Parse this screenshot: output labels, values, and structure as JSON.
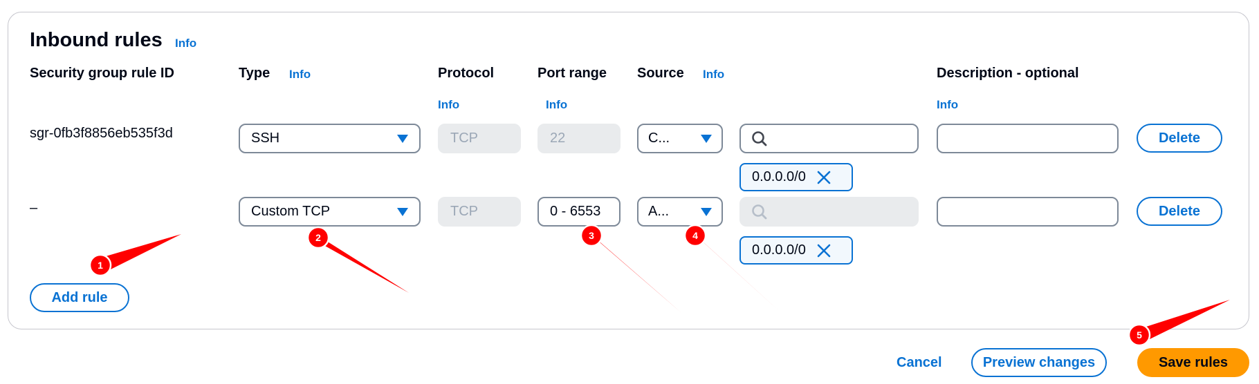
{
  "panel": {
    "title": "Inbound rules",
    "title_info": "Info"
  },
  "columns": {
    "rule_id": "Security group rule ID",
    "type": "Type",
    "type_info": "Info",
    "protocol": "Protocol",
    "protocol_info": "Info",
    "port_range": "Port range",
    "port_range_info": "Info",
    "source": "Source",
    "source_info": "Info",
    "description": "Description - optional",
    "description_info": "Info"
  },
  "rows": [
    {
      "rule_id": "sgr-0fb3f8856eb535f3d",
      "type": "SSH",
      "protocol": "TCP",
      "port_range": "22",
      "source": "C...",
      "search_value": "",
      "cidr_token": "0.0.0.0/0",
      "description": "",
      "delete_label": "Delete"
    },
    {
      "rule_id": "–",
      "type": "Custom TCP",
      "protocol": "TCP",
      "port_range": "0 - 6553",
      "source": "A...",
      "search_value": "",
      "cidr_token": "0.0.0.0/0",
      "description": "",
      "delete_label": "Delete"
    }
  ],
  "add_rule_label": "Add rule",
  "footer": {
    "cancel_label": "Cancel",
    "preview_label": "Preview changes",
    "save_label": "Save rules"
  },
  "annotations": [
    "1",
    "2",
    "3",
    "4",
    "5"
  ],
  "colors": {
    "accent": "#0972d3",
    "primary_button": "#ff9900",
    "annotation": "#ff0000"
  },
  "icons": {
    "caret": "caret-down-icon",
    "search": "search-icon",
    "remove": "close-icon"
  }
}
